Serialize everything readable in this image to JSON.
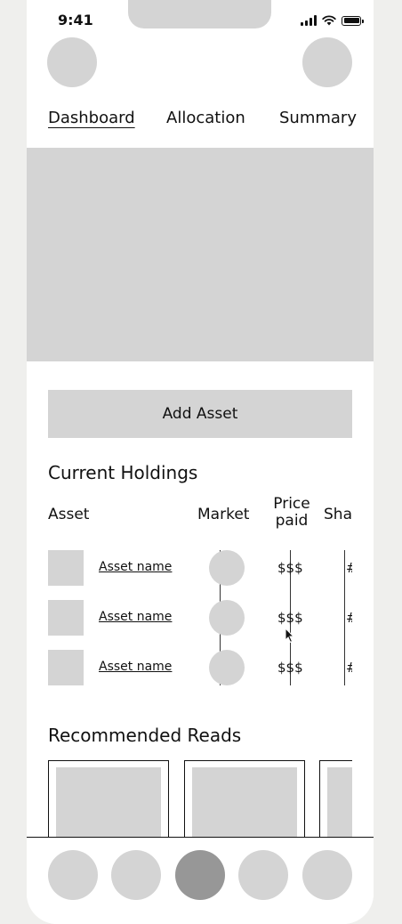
{
  "status_bar": {
    "time": "9:41"
  },
  "tabs": [
    {
      "label": "Dashboard",
      "active": true
    },
    {
      "label": "Allocation",
      "active": false
    },
    {
      "label": "Summary",
      "active": false
    }
  ],
  "add_asset_label": "Add Asset",
  "holdings": {
    "title": "Current Holdings",
    "columns": {
      "asset": "Asset",
      "market": "Market",
      "price_line1": "Price",
      "price_line2": "paid",
      "shares": "Sha"
    },
    "rows": [
      {
        "name": "Asset name",
        "price": "$$$",
        "shares": "#"
      },
      {
        "name": "Asset name",
        "price": "$$$",
        "shares": "#"
      },
      {
        "name": "Asset name",
        "price": "$$$",
        "shares": "#"
      }
    ]
  },
  "recommended": {
    "title": "Recommended Reads"
  },
  "colors": {
    "placeholder": "#d4d4d4",
    "nav_active": "#979797",
    "background": "#efefed"
  },
  "icons": {
    "cursor": "cursor-arrow-icon"
  }
}
